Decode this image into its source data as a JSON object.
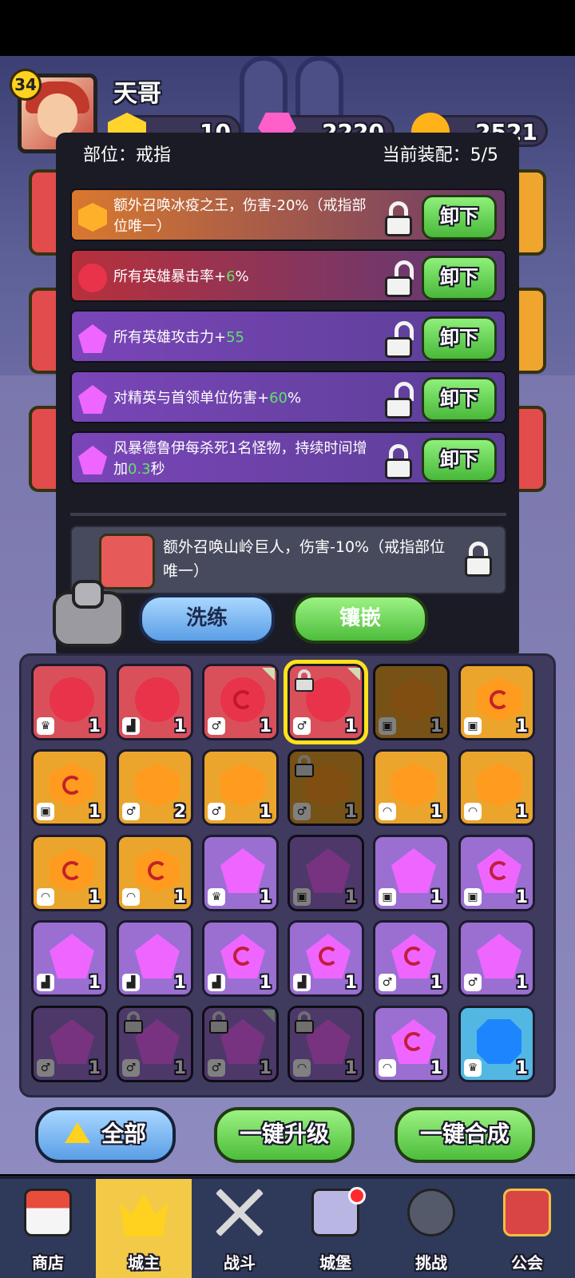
{
  "player": {
    "level": "34",
    "name": "天哥"
  },
  "currencies": {
    "gold": "10",
    "gems": "2220",
    "coins": "2521"
  },
  "popup": {
    "position_label": "部位：戒指",
    "equip_label": "当前装配：5/5",
    "rows": [
      {
        "pre": "额外召唤冰疫之王，伤害-20%（戒指部位唯一）",
        "hl": "",
        "post": "",
        "locked": true,
        "gem": "hex",
        "color": "orange"
      },
      {
        "pre": "所有英雄暴击率+",
        "hl": "6",
        "post": "%",
        "locked": false,
        "gem": "round",
        "color": "red"
      },
      {
        "pre": "所有英雄攻击力+",
        "hl": "55",
        "post": "",
        "locked": false,
        "gem": "pent",
        "color": "purple"
      },
      {
        "pre": "对精英与首领单位伤害+",
        "hl": "60",
        "post": "%",
        "locked": false,
        "gem": "pent",
        "color": "purple"
      },
      {
        "pre": "风暴德鲁伊每杀死1名怪物，持续时间增加",
        "hl": "0.3",
        "post": "秒",
        "locked": true,
        "gem": "pent",
        "color": "purple"
      }
    ],
    "unequip_label": "卸下",
    "extra_text": "额外召唤山岭巨人，伤害-10%（戒指部位唯一）",
    "refine_label": "洗练",
    "inlay_label": "镶嵌"
  },
  "inventory": [
    {
      "color": "red",
      "shape": "round",
      "slot": "crown",
      "count": "1"
    },
    {
      "color": "red",
      "shape": "round",
      "slot": "boot",
      "count": "1"
    },
    {
      "color": "red",
      "shape": "round",
      "slot": "ring",
      "count": "1",
      "swirl": true,
      "tri": true
    },
    {
      "color": "red",
      "shape": "round",
      "slot": "amulet",
      "count": "1",
      "lock": true,
      "tri": true,
      "selected": true
    },
    {
      "color": "orange",
      "shape": "hex",
      "slot": "armor",
      "count": "1",
      "dim": true
    },
    {
      "color": "orange",
      "shape": "hex",
      "slot": "armor",
      "count": "1",
      "swirl": true
    },
    {
      "color": "orange",
      "shape": "hex",
      "slot": "armor",
      "count": "1",
      "swirl": true
    },
    {
      "color": "orange",
      "shape": "hex",
      "slot": "amulet",
      "count": "2"
    },
    {
      "color": "orange",
      "shape": "hex",
      "slot": "amulet",
      "count": "1"
    },
    {
      "color": "orange",
      "shape": "hex",
      "slot": "amulet",
      "count": "1",
      "lock": true,
      "dim": true
    },
    {
      "color": "orange",
      "shape": "hex",
      "slot": "helmet",
      "count": "1"
    },
    {
      "color": "orange",
      "shape": "hex",
      "slot": "helmet",
      "count": "1"
    },
    {
      "color": "orange",
      "shape": "hex",
      "slot": "helmet",
      "count": "1",
      "swirl": true
    },
    {
      "color": "orange",
      "shape": "hex",
      "slot": "helmet",
      "count": "1",
      "swirl": true
    },
    {
      "color": "purple",
      "shape": "pent",
      "slot": "crown",
      "count": "1"
    },
    {
      "color": "purple",
      "shape": "pent",
      "slot": "armor",
      "count": "1",
      "dim": true
    },
    {
      "color": "purple",
      "shape": "pent",
      "slot": "armor",
      "count": "1"
    },
    {
      "color": "purple",
      "shape": "pent",
      "slot": "armor",
      "count": "1",
      "swirl": true
    },
    {
      "color": "purple",
      "shape": "pent",
      "slot": "boot",
      "count": "1"
    },
    {
      "color": "purple",
      "shape": "pent",
      "slot": "boot",
      "count": "1"
    },
    {
      "color": "purple",
      "shape": "pent",
      "slot": "boot",
      "count": "1",
      "swirl": true
    },
    {
      "color": "purple",
      "shape": "pent",
      "slot": "boot",
      "count": "1",
      "swirl": true
    },
    {
      "color": "purple",
      "shape": "pent",
      "slot": "ring",
      "count": "1",
      "swirl": true
    },
    {
      "color": "purple",
      "shape": "pent",
      "slot": "ring",
      "count": "1"
    },
    {
      "color": "purple",
      "shape": "pent",
      "slot": "ring",
      "count": "1",
      "dim": true
    },
    {
      "color": "purple",
      "shape": "pent",
      "slot": "ring",
      "count": "1",
      "lock": true,
      "dim": true
    },
    {
      "color": "purple",
      "shape": "pent",
      "slot": "ring",
      "count": "1",
      "lock": true,
      "dim": true,
      "tri": true
    },
    {
      "color": "purple",
      "shape": "pent",
      "slot": "helmet",
      "count": "1",
      "lock": true,
      "dim": true
    },
    {
      "color": "purple",
      "shape": "pent",
      "slot": "helmet",
      "count": "1",
      "swirl": true
    },
    {
      "color": "blue",
      "shape": "sq",
      "slot": "crown",
      "count": "1"
    }
  ],
  "slot_glyphs": {
    "crown": "♛",
    "boot": "▟",
    "ring": "♂",
    "amulet": "♂",
    "armor": "▣",
    "helmet": "◠"
  },
  "buttons": {
    "all": "全部",
    "upgrade": "一键升级",
    "merge": "一键合成"
  },
  "nav": [
    {
      "id": "shop",
      "label": "商店"
    },
    {
      "id": "lord",
      "label": "城主",
      "active": true
    },
    {
      "id": "battle",
      "label": "战斗"
    },
    {
      "id": "castle",
      "label": "城堡",
      "badge": true
    },
    {
      "id": "challenge",
      "label": "挑战"
    },
    {
      "id": "guild",
      "label": "公会"
    }
  ]
}
